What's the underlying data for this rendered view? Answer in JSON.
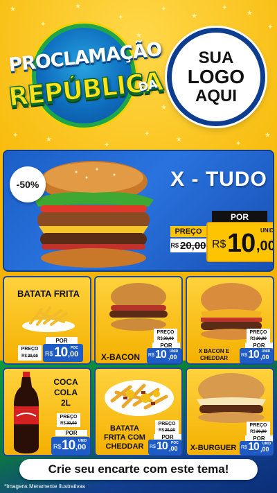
{
  "header": {
    "logo_line1": "PROCLAMAÇÃO",
    "logo_line2": "REPÚBLICA",
    "logo_da": "DA",
    "your_logo": [
      "SUA",
      "LOGO",
      "AQUI"
    ]
  },
  "hero": {
    "discount": "-50%",
    "title": "X - TUDO",
    "preco_label": "PREÇO",
    "old_currency": "R$",
    "old_price": "20,00",
    "por_label": "POR",
    "currency": "R$",
    "price_int": "10",
    "price_cents": ",00",
    "unit": "UNID"
  },
  "products": [
    {
      "name": "BATATA FRITA",
      "preco_label": "PREÇO",
      "old_currency": "R$",
      "old_price": "20,00",
      "por_label": "POR",
      "currency": "R$",
      "price_int": "10",
      "price_cents": ",00",
      "unit": "POC"
    },
    {
      "name": "X-BACON",
      "preco_label": "PREÇO",
      "old_currency": "R$",
      "old_price": "20,00",
      "por_label": "POR",
      "currency": "R$",
      "price_int": "10",
      "price_cents": ",00",
      "unit": "UNID"
    },
    {
      "name": "X BACON E CHEDDAR",
      "preco_label": "PREÇO",
      "old_currency": "R$",
      "old_price": "20,00",
      "por_label": "POR",
      "currency": "R$",
      "price_int": "10",
      "price_cents": ",00",
      "unit": "UNID"
    },
    {
      "name_lines": [
        "COCA",
        "COLA",
        "2L"
      ],
      "preco_label": "PREÇO",
      "old_currency": "R$",
      "old_price": "20,00",
      "por_label": "POR",
      "currency": "R$",
      "price_int": "10",
      "price_cents": ",00",
      "unit": "UNID"
    },
    {
      "name_lines": [
        "BATATA",
        "FRITA COM",
        "CHEDDAR"
      ],
      "preco_label": "PREÇO",
      "old_currency": "R$",
      "old_price": "20,00",
      "por_label": "POR",
      "currency": "R$",
      "price_int": "10",
      "price_cents": ",00",
      "unit": "POC"
    },
    {
      "name": "X-BURGUER",
      "preco_label": "PREÇO",
      "old_currency": "R$",
      "old_price": "20,00",
      "por_label": "POR",
      "currency": "R$",
      "price_int": "10",
      "price_cents": ",00",
      "unit": "UNID"
    }
  ],
  "footer": {
    "cta": "Crie seu encarte com este tema!",
    "disclaimer": "*Imagens Meramente Ilustrativas"
  },
  "colors": {
    "background_yellow": "#f4b400",
    "panel_blue": "#1e5bc5",
    "accent_green": "#0f9b3f"
  }
}
